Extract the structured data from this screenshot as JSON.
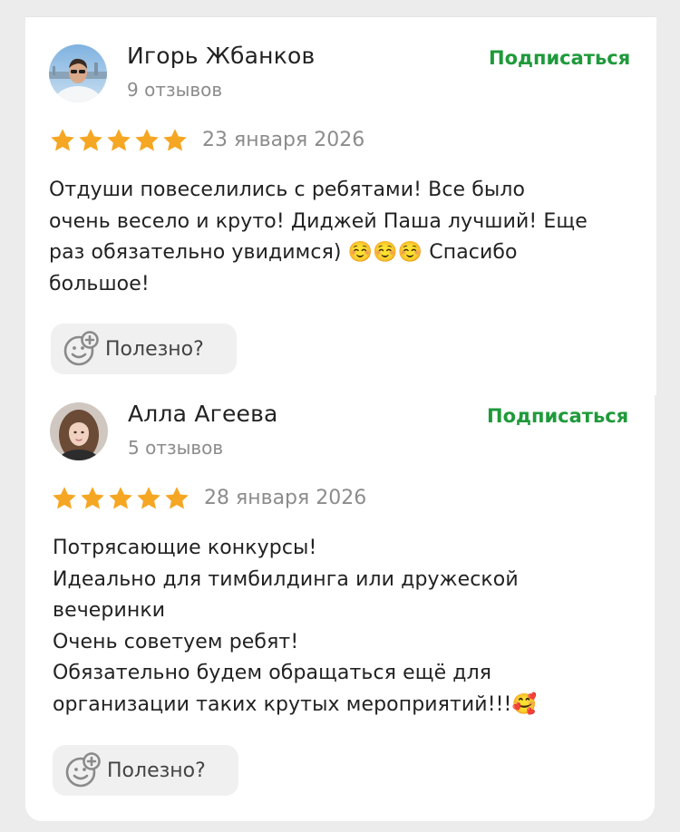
{
  "reviews": [
    {
      "author": "Игорь Жбанков",
      "reviews_count": "9 отзывов",
      "subscribe_label": "Подписаться",
      "rating": 5,
      "date": "23 января 2026",
      "text_lines": [
        "Отдуши повеселились с ребятами! Все было",
        "очень весело и круто! Диджей Паша лучший! Еще",
        "раз обязательно увидимся) ☺️☺️☺️ Спасибо",
        "большое!"
      ],
      "helpful_label": "Полезно?"
    },
    {
      "author": "Алла Агеева",
      "reviews_count": "5 отзывов",
      "subscribe_label": "Подписаться",
      "rating": 5,
      "date": "28 января 2026",
      "text_lines": [
        "Потрясающие конкурсы!",
        "Идеально для тимбилдинга или дружеской",
        "вечеринки",
        "Очень советуем ребят!",
        "Обязательно будем обращаться ещё для",
        "организации таких крутых мероприятий!!!🥰"
      ],
      "helpful_label": "Полезно?"
    }
  ],
  "colors": {
    "accent_green": "#1f9a3b",
    "star_orange": "#f5a623",
    "secondary_text": "#8c8c8c"
  },
  "icons": {
    "star": "star-icon",
    "helpful": "smile-plus-icon"
  }
}
